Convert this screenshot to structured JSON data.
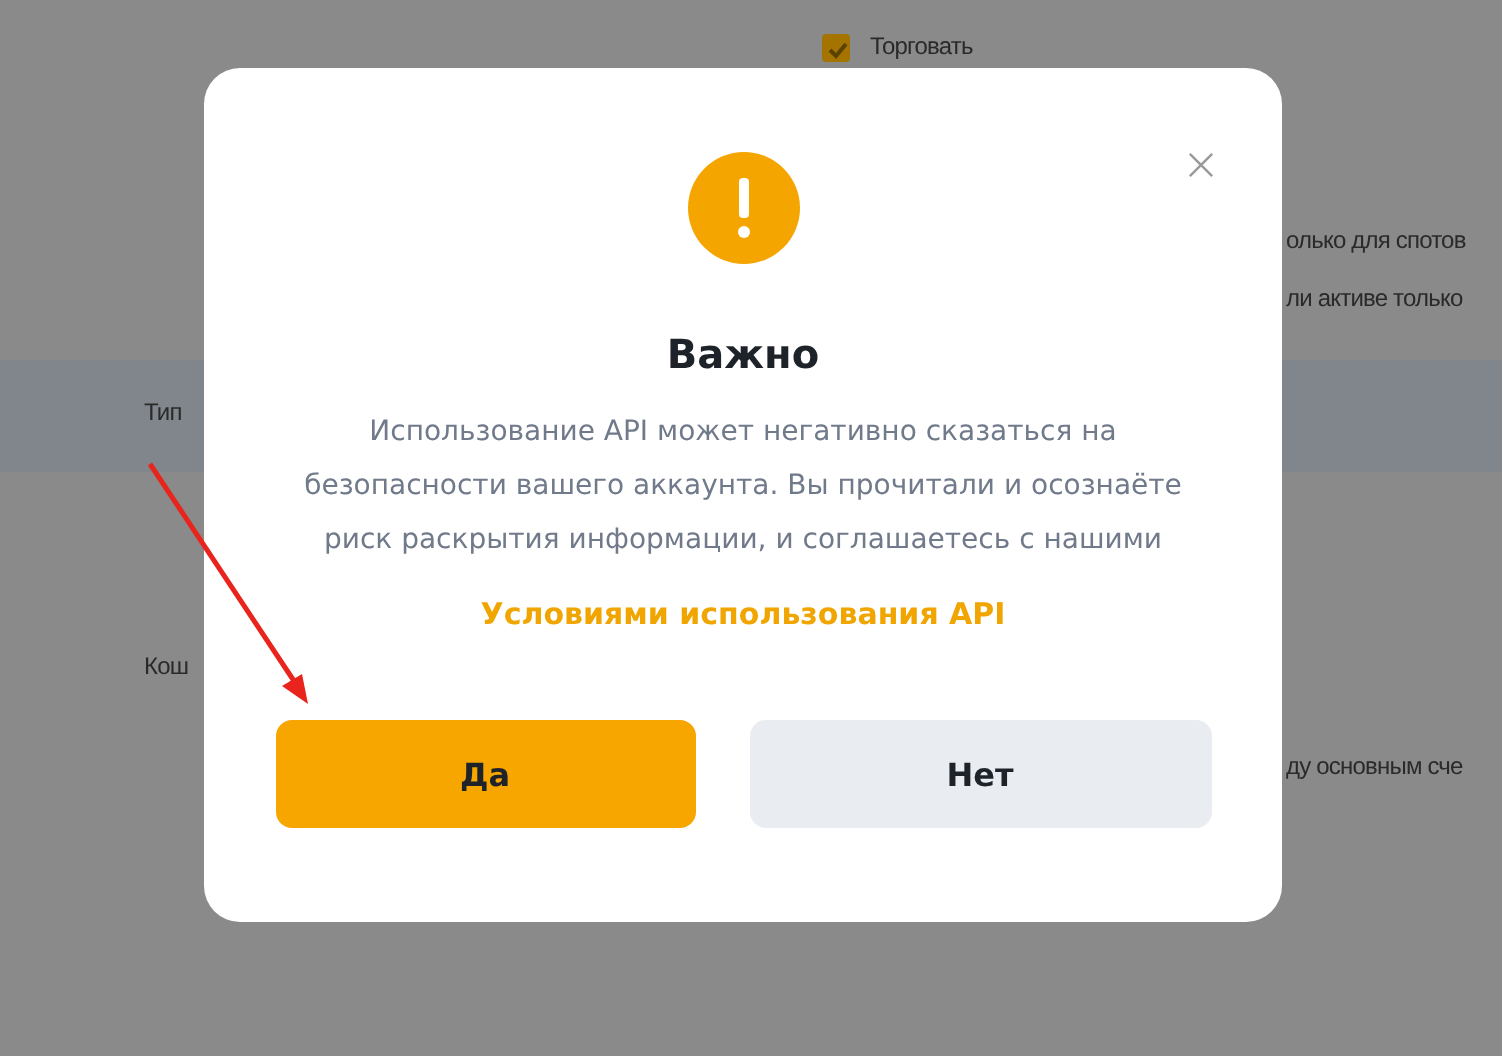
{
  "background": {
    "checkbox": {
      "label": "Торговать",
      "checked": true
    },
    "texts": [
      "олько для спотов",
      "ли активе только",
      "Тип",
      "Кош",
      "ду основным сче"
    ]
  },
  "dialog": {
    "title": "Важно",
    "message": "Использование API может негативно сказаться на безопасности вашего аккаунта. Вы прочитали и осознаёте риск раскрытия информации, и соглашаетесь с нашими",
    "link": "Условиями использования API",
    "buttons": [
      {
        "label": "Да",
        "kind": "primary"
      },
      {
        "label": "Нет",
        "kind": "secondary"
      }
    ]
  }
}
